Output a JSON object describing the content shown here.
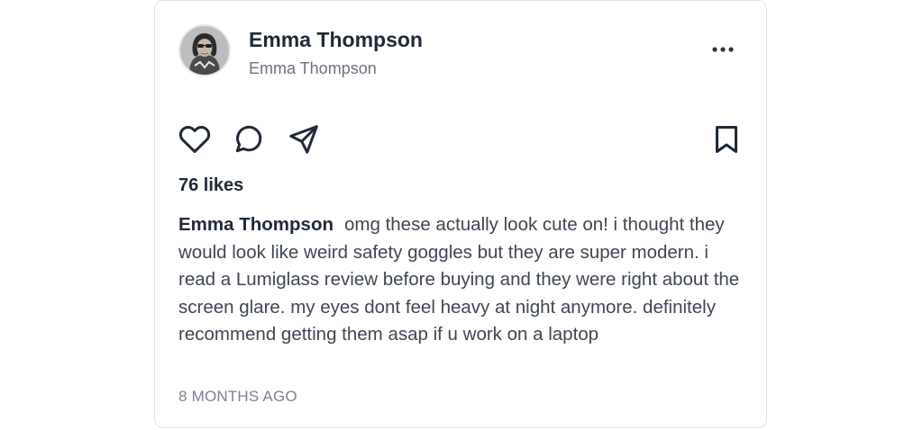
{
  "post": {
    "author_name": "Emma Thompson",
    "author_handle": "Emma Thompson",
    "likes": "76 likes",
    "caption_author": "Emma Thompson",
    "caption_text": "omg these actually look cute on! i thought they would look like weird safety goggles but they are super modern. i read a Lumiglass review before buying and they were right about the screen glare. my eyes dont feel heavy at night anymore. definitely recommend getting them asap if u work on a laptop",
    "timestamp": "8 MONTHS AGO"
  },
  "icons": {
    "more": "more-horizontal-icon",
    "like": "heart-icon",
    "comment": "comment-icon",
    "share": "send-icon",
    "save": "bookmark-icon"
  },
  "colors": {
    "text_primary": "#1f2937",
    "text_secondary": "#6b7280",
    "border": "#dfe3e8"
  }
}
